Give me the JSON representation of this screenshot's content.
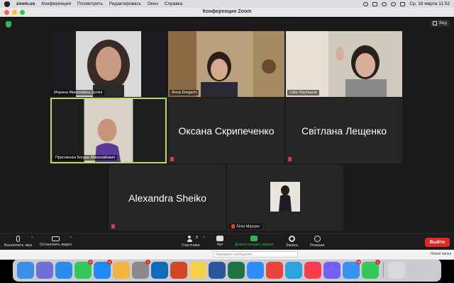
{
  "menubar": {
    "app": "zoom.us",
    "items": [
      "Конференция",
      "Посмотреть",
      "Редактировать",
      "Окно",
      "Справка"
    ],
    "clock": "Ср, 16 марта 11:52"
  },
  "window": {
    "title": "Конференция Zoom"
  },
  "view_button": {
    "label": "Вид"
  },
  "tiles": [
    {
      "name": "Марина Миколаївна Деліні",
      "type": "video"
    },
    {
      "name": "Anna Dergach",
      "type": "video"
    },
    {
      "name": "Lidia Shynkaruk",
      "type": "video"
    },
    {
      "name": "Присяжнюк Богдан Миколайович",
      "type": "video",
      "active": true
    },
    {
      "name": "Оксана Скрипеченко",
      "type": "name",
      "muted": true
    },
    {
      "name": "Світлана Лещенко",
      "type": "name",
      "muted": true
    },
    {
      "name": "Alexandra Sheiko",
      "type": "name",
      "muted": true
    },
    {
      "name": "Лілія Маскин",
      "type": "avatar",
      "muted": true
    }
  ],
  "toolbar": {
    "mute_label": "Выключить звук",
    "video_label": "Остановить видео",
    "participants_label": "Участники",
    "participants_count": "8",
    "chat_label": "Чат",
    "share_label": "Демонстрация экрана",
    "record_label": "Запись",
    "reactions_label": "Реакции",
    "leave_label": "Выйти"
  },
  "background_window": {
    "field_placeholder": "Напишите сообщение...",
    "side_text": "Новая папка"
  },
  "dock": {
    "apps": [
      {
        "name": "finder-icon",
        "color": "#3b8fe8"
      },
      {
        "name": "launchpad-icon",
        "color": "#6f6fd8"
      },
      {
        "name": "safari-icon",
        "color": "#2a8af0"
      },
      {
        "name": "facetime-icon",
        "color": "#34c759",
        "badge": "9"
      },
      {
        "name": "app-store-icon",
        "color": "#1d8cf8",
        "badge": "6"
      },
      {
        "name": "photos-icon",
        "color": "#f5b342"
      },
      {
        "name": "system-preferences-icon",
        "color": "#8a8a8e",
        "badge": "1"
      },
      {
        "name": "outlook-icon",
        "color": "#0f6cbd"
      },
      {
        "name": "powerpoint-icon",
        "color": "#d24726"
      },
      {
        "name": "notes-icon",
        "color": "#f5d24a"
      },
      {
        "name": "word-icon",
        "color": "#2b579a"
      },
      {
        "name": "excel-icon",
        "color": "#217346"
      },
      {
        "name": "zoom-icon",
        "color": "#2d8cff"
      },
      {
        "name": "chrome-icon",
        "color": "#e8453c"
      },
      {
        "name": "telegram-icon",
        "color": "#2aa3e0"
      },
      {
        "name": "music-icon",
        "color": "#fa3c4c"
      },
      {
        "name": "viber-icon",
        "color": "#7360f2"
      },
      {
        "name": "mail-icon",
        "color": "#3a92f0",
        "badge": "16"
      },
      {
        "name": "messages-icon",
        "color": "#34c759",
        "badge": "1"
      },
      {
        "name": "documents-icon",
        "color": "#d8d8de"
      },
      {
        "name": "trash-icon",
        "color": "#c9c9cf"
      }
    ]
  }
}
